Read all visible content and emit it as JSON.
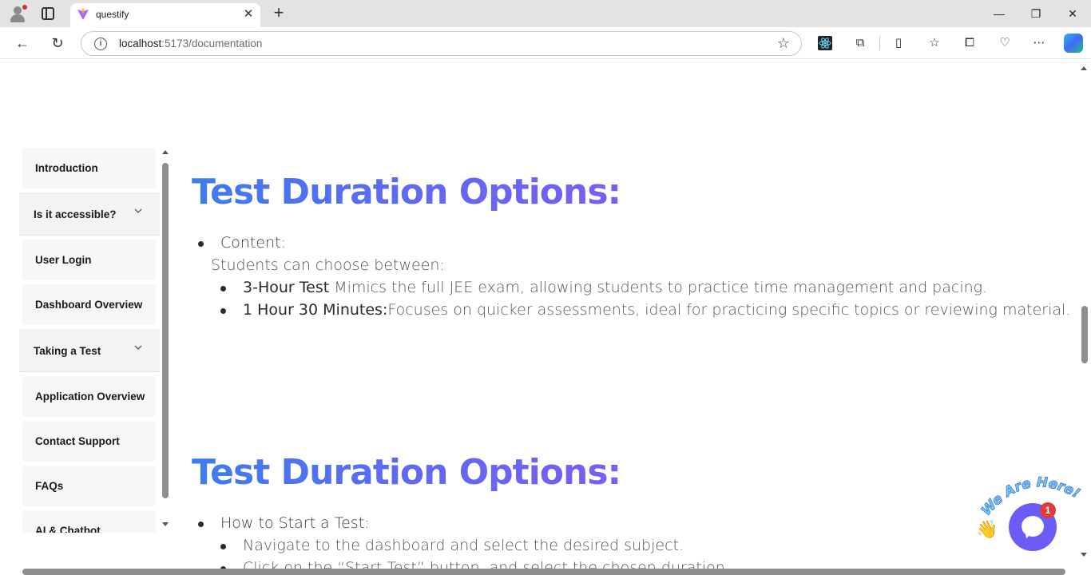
{
  "browser": {
    "tab_title": "questify",
    "close_tab_symbol": "✕",
    "new_tab_symbol": "+",
    "url_host": "localhost",
    "url_path": ":5173/documentation",
    "window_controls": {
      "minimize": "—",
      "restore": "❐",
      "close": "✕"
    }
  },
  "sidebar": {
    "items": [
      {
        "label": "Introduction",
        "type": "item"
      },
      {
        "label": "Is it accessible?",
        "type": "group"
      },
      {
        "label": "User Login",
        "type": "item"
      },
      {
        "label": "Dashboard Overview",
        "type": "item"
      },
      {
        "label": "Taking a Test",
        "type": "group"
      },
      {
        "label": "Application Overview",
        "type": "item"
      },
      {
        "label": "Contact Support",
        "type": "item"
      },
      {
        "label": "FAQs",
        "type": "item"
      },
      {
        "label": "AI & Chatbot",
        "type": "item"
      }
    ]
  },
  "sections": [
    {
      "heading": "Test Duration Options:",
      "bullet_title": "Content:",
      "intro": "Students can choose between:",
      "subitems": [
        {
          "strong": "3-Hour Test",
          "text": " Mimics the full JEE exam, allowing students to practice time management and pacing."
        },
        {
          "strong": "1 Hour 30 Minutes:",
          "text": "Focuses on quicker assessments, ideal for practicing specific topics or reviewing material."
        }
      ]
    },
    {
      "heading": "Test Duration Options:",
      "bullet_title": "How to Start a Test:",
      "subitems": [
        {
          "text": "Navigate to the dashboard and select the desired subject."
        },
        {
          "text": "Click on the “Start Test” button, and select the chosen duration."
        }
      ]
    }
  ],
  "chat_widget": {
    "banner_text": "We Are Here!",
    "badge_count": "1",
    "wave_emoji": "👋",
    "accent_color": "#6a5cf6"
  },
  "colors": {
    "heading_gradient_start": "#3e7cf0",
    "heading_gradient_end": "#7a5ef0"
  }
}
